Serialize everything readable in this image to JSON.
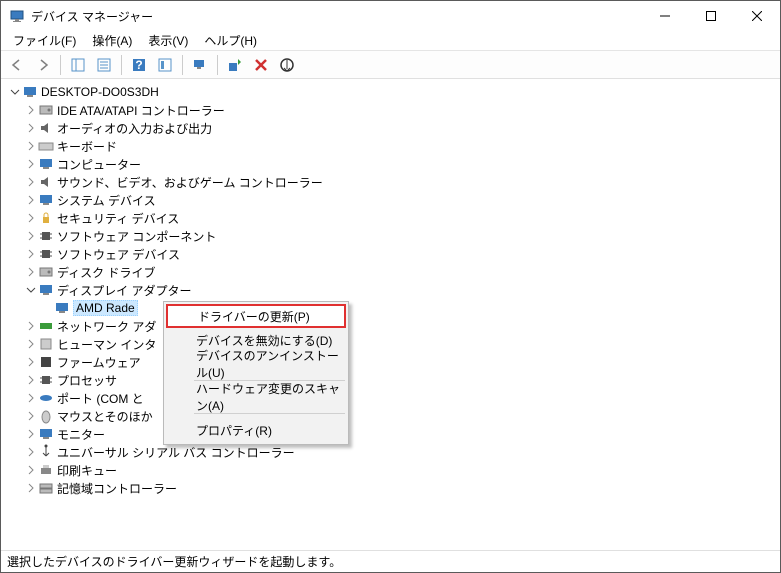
{
  "window": {
    "title": "デバイス マネージャー"
  },
  "menu": {
    "file": "ファイル(F)",
    "action": "操作(A)",
    "view": "表示(V)",
    "help": "ヘルプ(H)"
  },
  "tree": {
    "root": "DESKTOP-DO0S3DH",
    "items": [
      "IDE ATA/ATAPI コントローラー",
      "オーディオの入力および出力",
      "キーボード",
      "コンピューター",
      "サウンド、ビデオ、およびゲーム コントローラー",
      "システム デバイス",
      "セキュリティ デバイス",
      "ソフトウェア コンポーネント",
      "ソフトウェア デバイス",
      "ディスク ドライブ"
    ],
    "display_adapter": "ディスプレイ アダプター",
    "selected_device": "AMD Rade",
    "items_after": [
      "ネットワーク アダ",
      "ヒューマン インタ",
      "ファームウェア",
      "プロセッサ",
      "ポート (COM と",
      "マウスとそのほか",
      "モニター",
      "ユニバーサル シリアル バス コントローラー",
      "印刷キュー",
      "記憶域コントローラー"
    ]
  },
  "context_menu": {
    "update_driver": "ドライバーの更新(P)",
    "disable_device": "デバイスを無効にする(D)",
    "uninstall_device": "デバイスのアンインストール(U)",
    "scan_hardware": "ハードウェア変更のスキャン(A)",
    "properties": "プロパティ(R)"
  },
  "statusbar": {
    "text": "選択したデバイスのドライバー更新ウィザードを起動します。"
  }
}
